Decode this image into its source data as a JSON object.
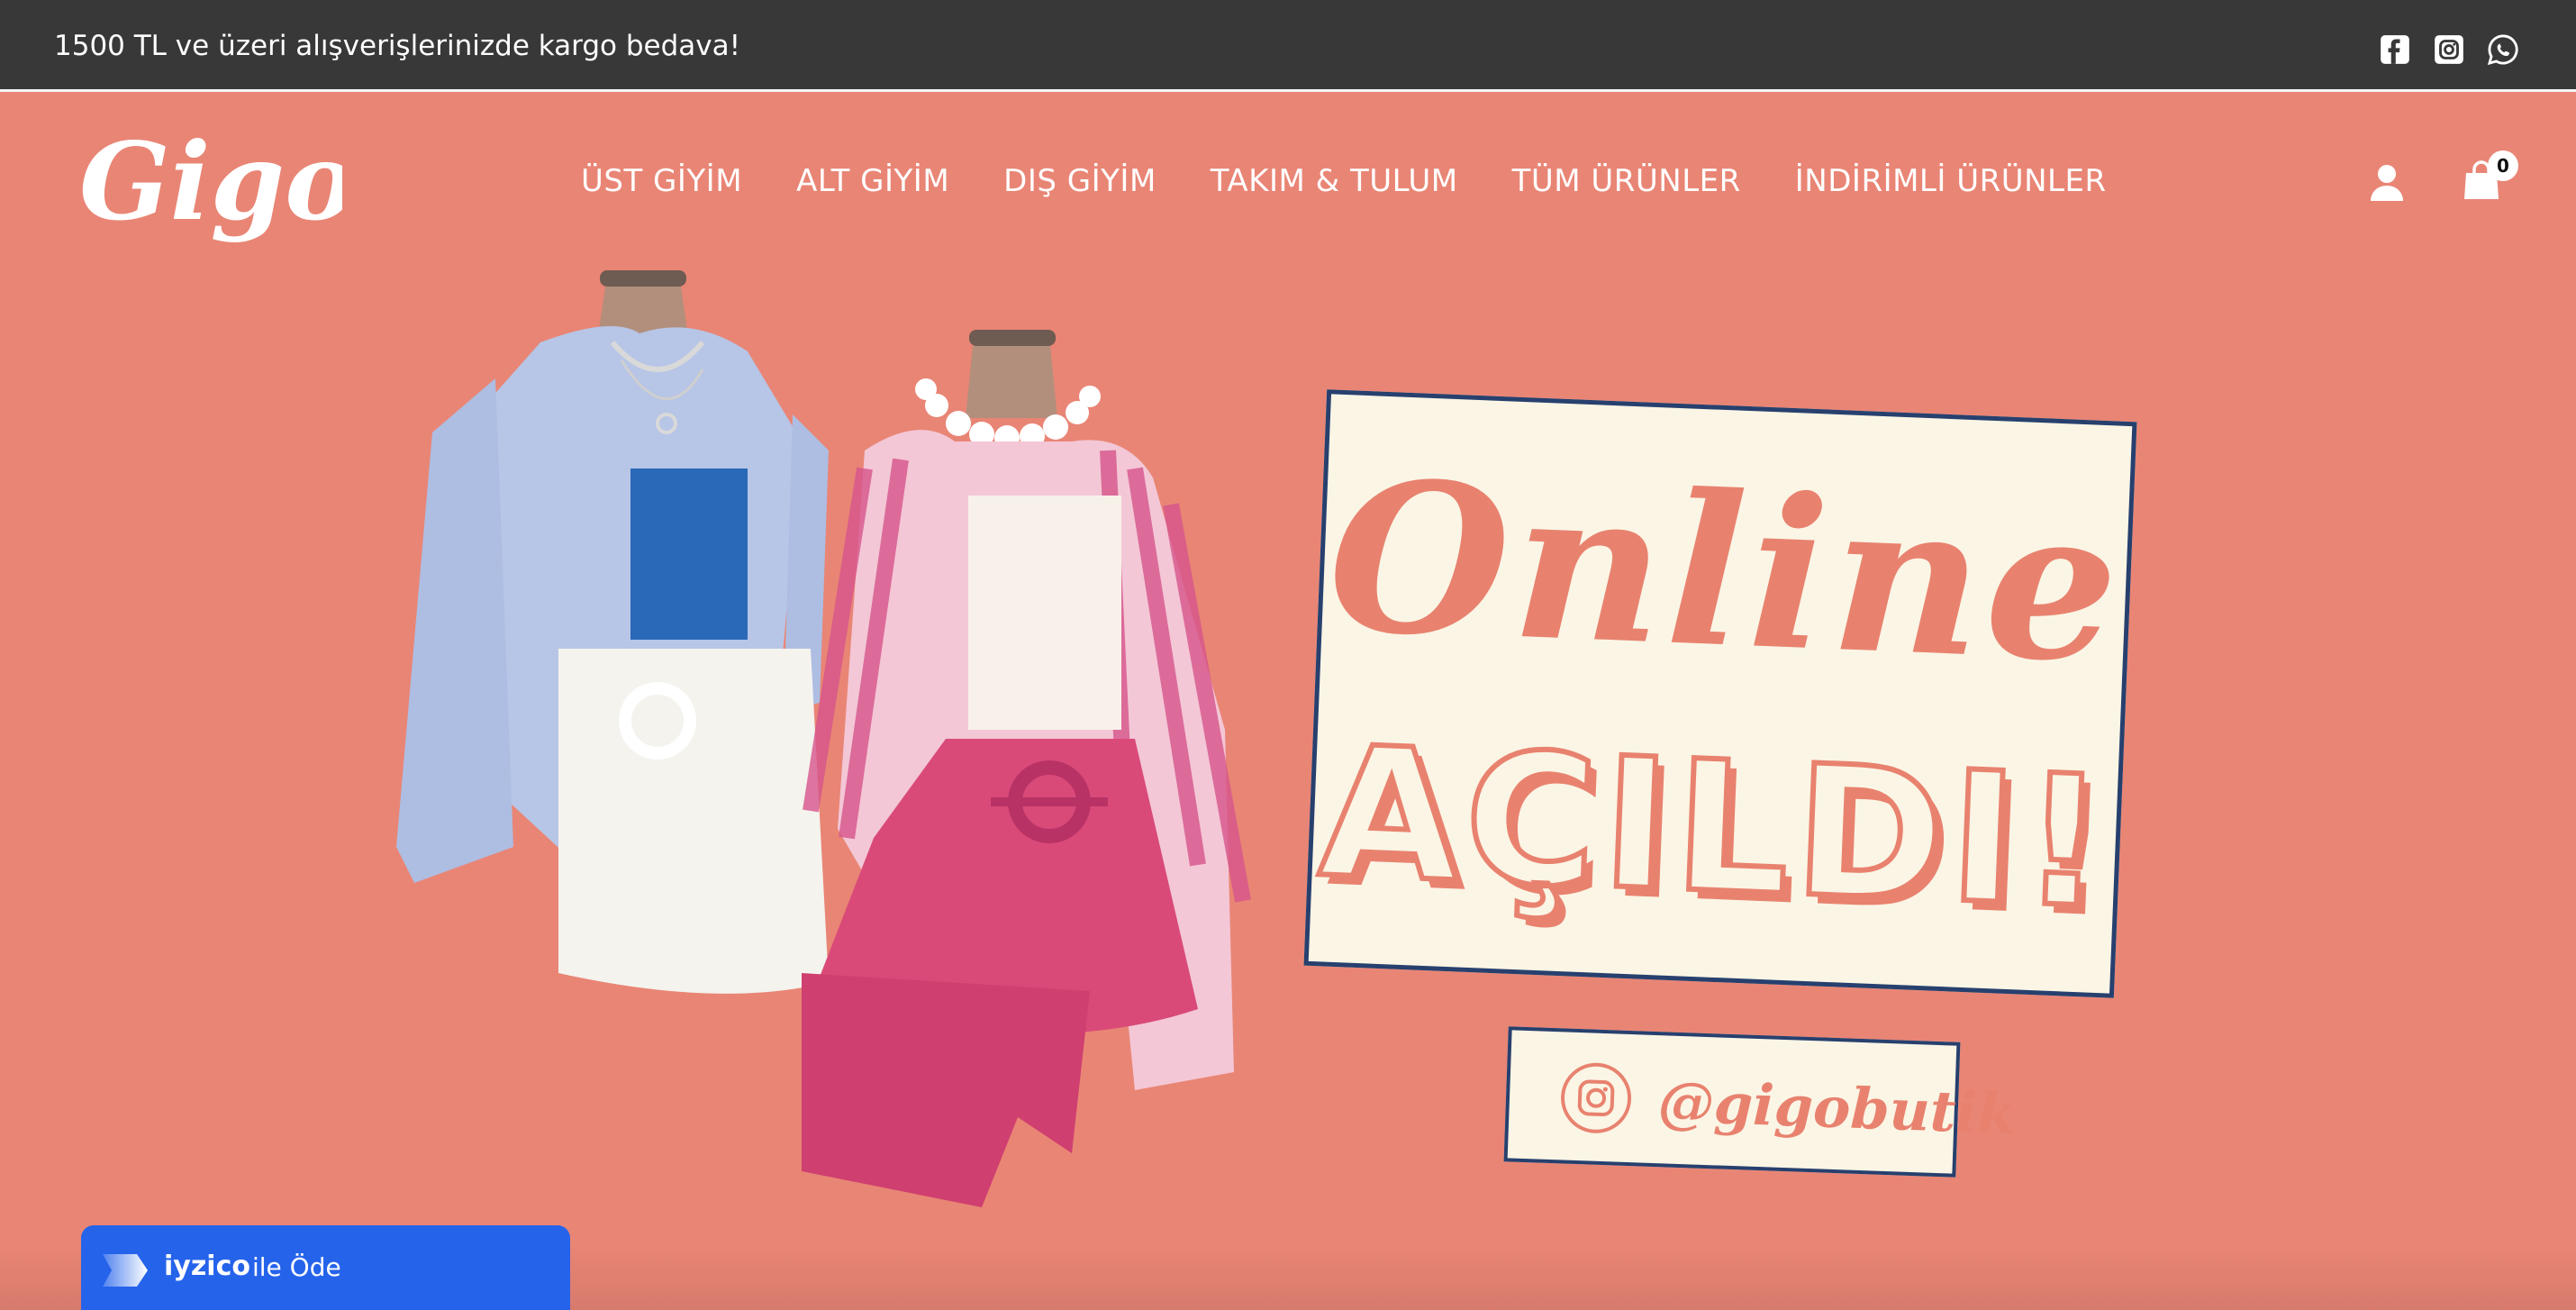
{
  "announcement": {
    "text": "1500 TL ve üzeri alışverişlerinizde kargo bedava!"
  },
  "social_icons": [
    "facebook-icon",
    "instagram-icon",
    "whatsapp-icon"
  ],
  "logo": {
    "text": "Gigo"
  },
  "nav": {
    "items": [
      {
        "label": "ÜST GİYİM"
      },
      {
        "label": "ALT GİYİM"
      },
      {
        "label": "DIŞ GİYİM"
      },
      {
        "label": "TAKIM & TULUM"
      },
      {
        "label": "TÜM ÜRÜNLER"
      },
      {
        "label": "İNDİRİMLİ ÜRÜNLER"
      }
    ]
  },
  "header_icons": [
    "user-icon",
    "shopping-bag-icon"
  ],
  "cart": {
    "count": "0"
  },
  "hero": {
    "line1": "Online",
    "line2": "AÇILDI!",
    "instagram_handle": "@gigobutik"
  },
  "pay_widget": {
    "brand": "iyzico",
    "text": "ile Öde"
  },
  "colors": {
    "background": "#e98575",
    "topbar": "#383838",
    "card": "#fbf5e5",
    "card_border": "#27406e",
    "accent": "#e8826f",
    "pay": "#2563eb"
  }
}
